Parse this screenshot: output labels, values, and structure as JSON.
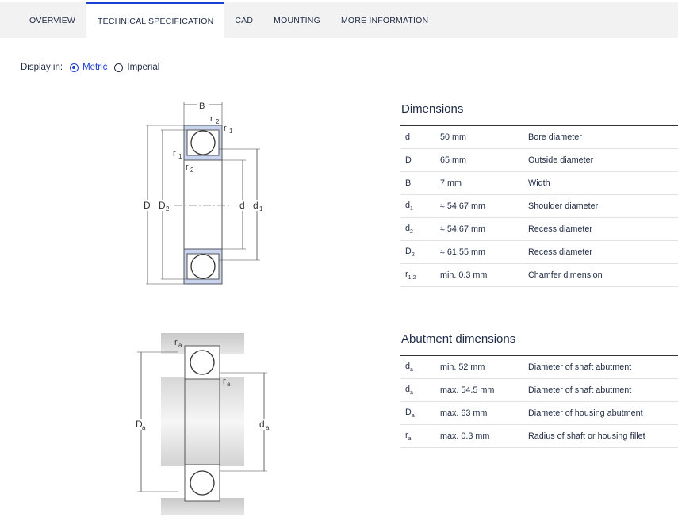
{
  "tabs": [
    {
      "label": "OVERVIEW"
    },
    {
      "label": "TECHNICAL SPECIFICATION"
    },
    {
      "label": "CAD"
    },
    {
      "label": "MOUNTING"
    },
    {
      "label": "MORE INFORMATION"
    }
  ],
  "display": {
    "label": "Display in:",
    "options": [
      {
        "label": "Metric",
        "selected": true
      },
      {
        "label": "Imperial",
        "selected": false
      }
    ]
  },
  "accent_color": "#1c3fd6",
  "drawing_labels": {
    "B": "B",
    "r": "r",
    "sub1": "1",
    "sub2": "2",
    "D": "D",
    "D2": "D",
    "d": "d",
    "d1": "d",
    "ra": "r",
    "Da": "D",
    "da": "d",
    "suba": "a"
  },
  "dimensions": {
    "title": "Dimensions",
    "rows": [
      {
        "symbol": "d",
        "sub": "",
        "value": "50 mm",
        "description": "Bore diameter"
      },
      {
        "symbol": "D",
        "sub": "",
        "value": "65 mm",
        "description": "Outside diameter"
      },
      {
        "symbol": "B",
        "sub": "",
        "value": "7 mm",
        "description": "Width"
      },
      {
        "symbol": "d",
        "sub": "1",
        "value": "≈ 54.67 mm",
        "description": "Shoulder diameter"
      },
      {
        "symbol": "d",
        "sub": "2",
        "value": "≈ 54.67 mm",
        "description": "Recess diameter"
      },
      {
        "symbol": "D",
        "sub": "2",
        "value": "≈ 61.55 mm",
        "description": "Recess diameter"
      },
      {
        "symbol": "r",
        "sub": "1,2",
        "value": "min. 0.3 mm",
        "description": "Chamfer dimension"
      }
    ]
  },
  "abutment": {
    "title": "Abutment dimensions",
    "rows": [
      {
        "symbol": "d",
        "sub": "a",
        "value": "min. 52 mm",
        "description": "Diameter of shaft abutment"
      },
      {
        "symbol": "d",
        "sub": "a",
        "value": "max. 54.5 mm",
        "description": "Diameter of shaft abutment"
      },
      {
        "symbol": "D",
        "sub": "a",
        "value": "max. 63 mm",
        "description": "Diameter of housing abutment"
      },
      {
        "symbol": "r",
        "sub": "a",
        "value": "max. 0.3 mm",
        "description": "Radius of shaft or housing fillet"
      }
    ]
  }
}
